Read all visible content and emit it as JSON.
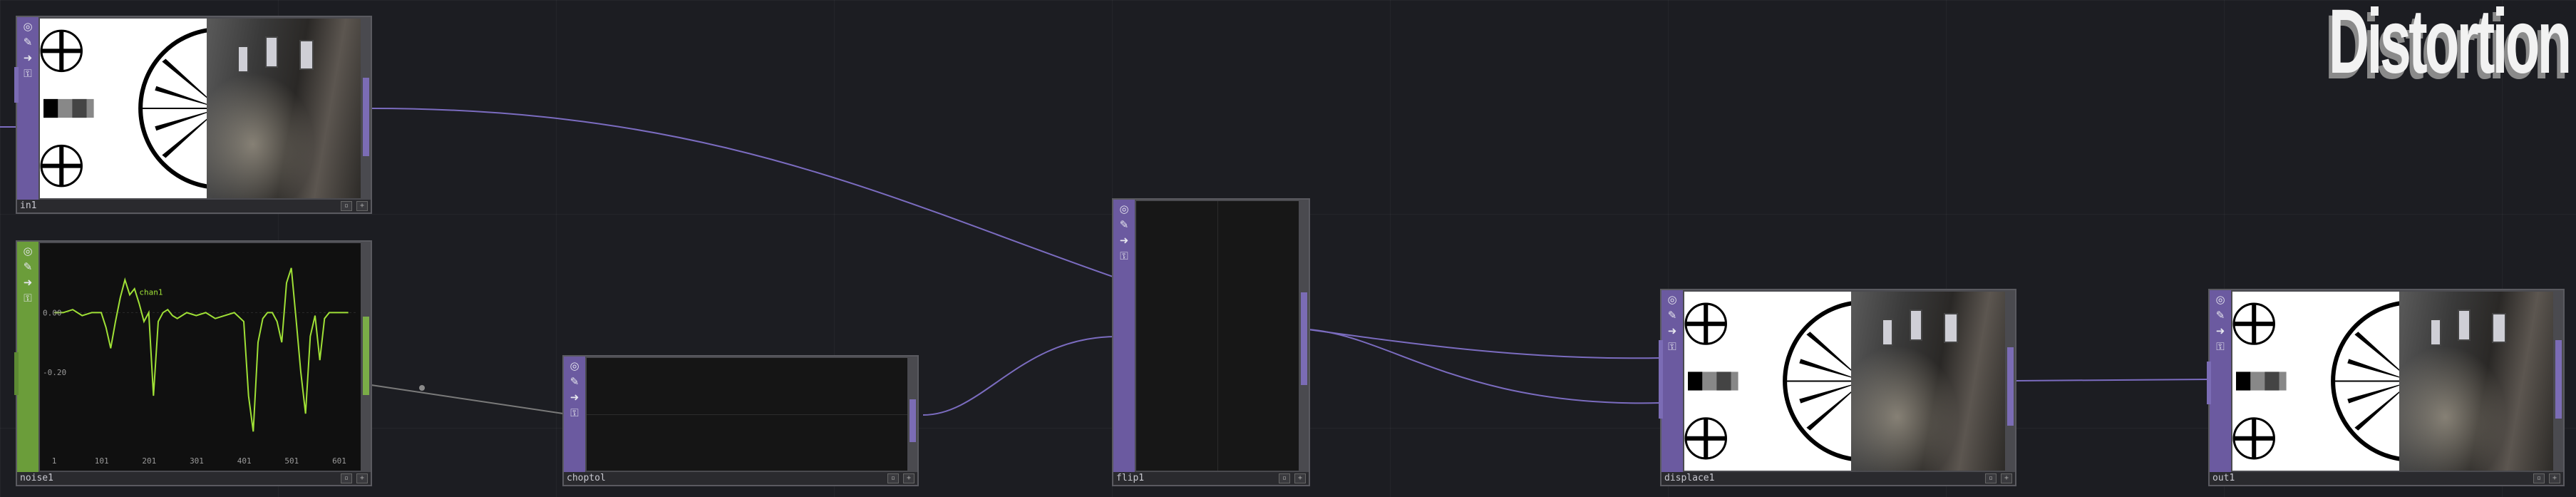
{
  "page": {
    "title": "Distortion"
  },
  "nodes": {
    "in1": {
      "name": "in1"
    },
    "noise1": {
      "name": "noise1",
      "channel": "chan1",
      "y_labels": [
        "0.00",
        "-0.20"
      ],
      "x_labels": [
        "1",
        "101",
        "201",
        "301",
        "401",
        "501",
        "601"
      ]
    },
    "choptoi": {
      "name": "choptol"
    },
    "flip1": {
      "name": "flip1"
    },
    "displace1": {
      "name": "displace1"
    },
    "out1": {
      "name": "out1"
    }
  },
  "icons": {
    "strip_top": "target-icon",
    "strip_2": "pin-icon",
    "strip_3": "arrow-right-icon",
    "strip_4": "paint-icon"
  },
  "colors": {
    "background": "#1c1d22",
    "top_strip": "#6b5aa0",
    "chop_strip": "#6b9d3a",
    "wire": "#7b6cc0",
    "chop_wire": "#8a8a8a",
    "chart_line": "#9fe036"
  },
  "chart_data": {
    "type": "line",
    "series": [
      {
        "name": "chan1",
        "x": [
          1,
          20,
          40,
          60,
          80,
          100,
          110,
          120,
          130,
          140,
          150,
          160,
          170,
          180,
          190,
          200,
          210,
          220,
          230,
          240,
          250,
          260,
          280,
          300,
          320,
          340,
          360,
          380,
          400,
          410,
          420,
          430,
          440,
          450,
          460,
          470,
          480,
          490,
          500,
          510,
          520,
          530,
          540,
          550,
          560,
          570,
          580,
          600,
          620
        ],
        "y": [
          0.0,
          0.0,
          0.01,
          -0.01,
          0.0,
          0.0,
          -0.05,
          -0.12,
          -0.03,
          0.05,
          0.11,
          0.06,
          0.08,
          0.03,
          -0.03,
          0.0,
          -0.28,
          -0.03,
          0.0,
          0.01,
          -0.01,
          -0.02,
          0.0,
          -0.01,
          0.0,
          -0.02,
          -0.01,
          0.0,
          -0.03,
          -0.28,
          -0.4,
          -0.1,
          -0.02,
          0.0,
          0.0,
          -0.03,
          -0.1,
          0.1,
          0.15,
          -0.02,
          -0.2,
          -0.34,
          -0.08,
          -0.01,
          -0.16,
          -0.02,
          0.0,
          0.0,
          0.0
        ]
      }
    ],
    "xlim": [
      1,
      640
    ],
    "ylim": [
      -0.45,
      0.2
    ],
    "xticks": [
      1,
      101,
      201,
      301,
      401,
      501,
      601
    ],
    "yticks": [
      0.0,
      -0.2
    ],
    "xlabel": "",
    "ylabel": "",
    "grid": false
  }
}
